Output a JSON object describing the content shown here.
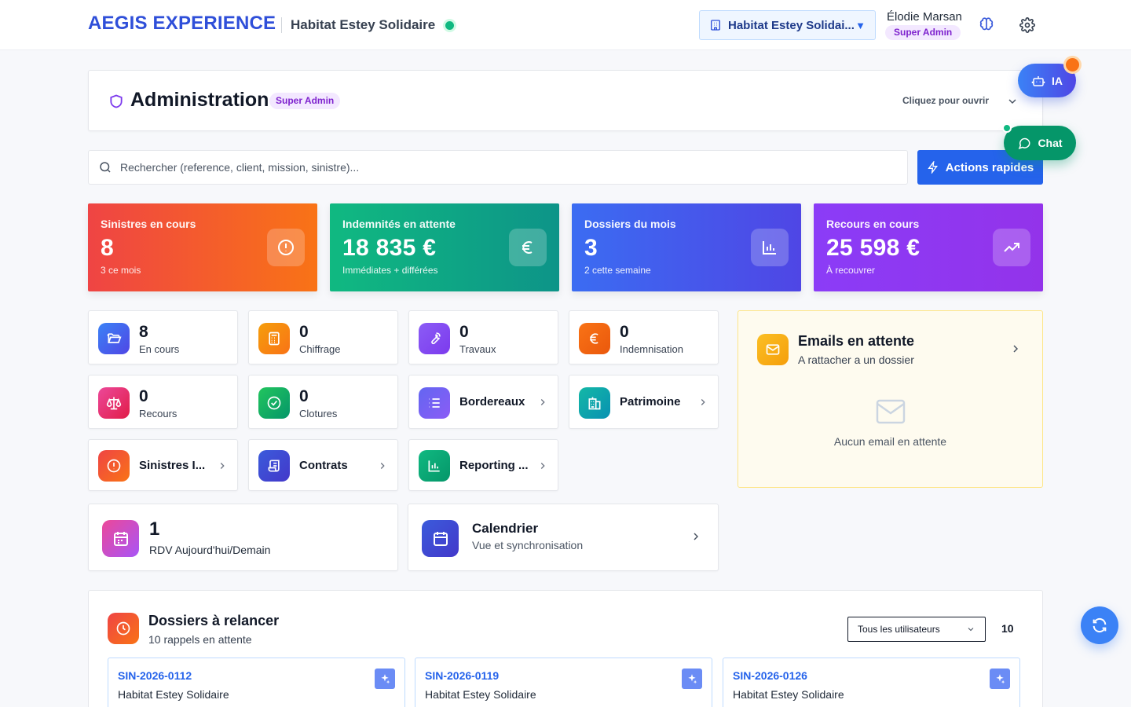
{
  "header": {
    "brand": "AEGIS EXPERIENCE",
    "org_name": "Habitat Estey Solidaire",
    "org_select": "Habitat Estey Solidai...",
    "org_select_caret": "▼",
    "user_name": "Élodie Marsan",
    "user_role": "Super Admin"
  },
  "admin": {
    "title": "Administration",
    "badge": "Super Admin",
    "hint": "Cliquez pour ouvrir"
  },
  "search": {
    "placeholder": "Rechercher (reference, client, mission, sinistre)..."
  },
  "quick_actions": {
    "label": "Actions rapides"
  },
  "kpis": [
    {
      "label": "Sinistres en cours",
      "value": "8",
      "sub": "3 ce mois"
    },
    {
      "label": "Indemnités en attente",
      "value": "18 835 €",
      "sub": "Immédiates + différées"
    },
    {
      "label": "Dossiers du mois",
      "value": "3",
      "sub": "2 cette semaine"
    },
    {
      "label": "Recours en cours",
      "value": "25 598 €",
      "sub": "À recouvrer"
    }
  ],
  "stats": [
    {
      "value": "8",
      "label": "En cours"
    },
    {
      "value": "0",
      "label": "Chiffrage"
    },
    {
      "value": "0",
      "label": "Travaux"
    },
    {
      "value": "0",
      "label": "Indemnisation"
    },
    {
      "value": "0",
      "label": "Recours"
    },
    {
      "value": "0",
      "label": "Clotures"
    }
  ],
  "links": {
    "bordereaux": "Bordereaux",
    "patrimoine": "Patrimoine",
    "sinistres": "Sinistres I...",
    "contrats": "Contrats",
    "reporting": "Reporting ..."
  },
  "emails": {
    "title": "Emails en attente",
    "sub": "A rattacher a un dossier",
    "empty": "Aucun email en attente"
  },
  "rdv": {
    "value": "1",
    "label": "RDV Aujourd'hui/Demain"
  },
  "calendar": {
    "title": "Calendrier",
    "sub": "Vue et synchronisation"
  },
  "dossiers": {
    "title": "Dossiers à relancer",
    "sub": "10 rappels en attente",
    "filter": "Tous les utilisateurs",
    "count": "10",
    "cards": [
      {
        "ref": "SIN-2026-0112",
        "client": "Habitat Estey Solidaire"
      },
      {
        "ref": "SIN-2026-0119",
        "client": "Habitat Estey Solidaire"
      },
      {
        "ref": "SIN-2026-0126",
        "client": "Habitat Estey Solidaire"
      }
    ]
  },
  "floating": {
    "ia": "IA",
    "chat": "Chat"
  }
}
